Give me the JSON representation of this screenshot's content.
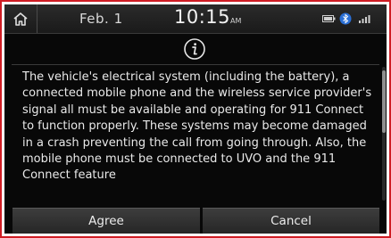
{
  "status_bar": {
    "date": "Feb.  1",
    "time": "10:15",
    "ampm": "AM"
  },
  "icons": {
    "home": "home-icon",
    "info": "info-icon",
    "battery": "battery-icon",
    "bluetooth": "bluetooth-icon",
    "signal": "signal-icon"
  },
  "dialog": {
    "message": "The vehicle's electrical system (including the battery), a connected mobile phone and the wireless service provider's signal all must be available and operating for 911 Connect to function properly. These systems may become damaged in a crash preventing the call from going through. Also, the mobile phone must be connected to UVO and the 911 Connect feature",
    "agree_label": "Agree",
    "cancel_label": "Cancel",
    "scroll_position": 0.0
  },
  "colors": {
    "frame_border": "#cf1d24",
    "screen_background": "#080808",
    "button_background": "#333333",
    "text": "#e9e9e9"
  }
}
